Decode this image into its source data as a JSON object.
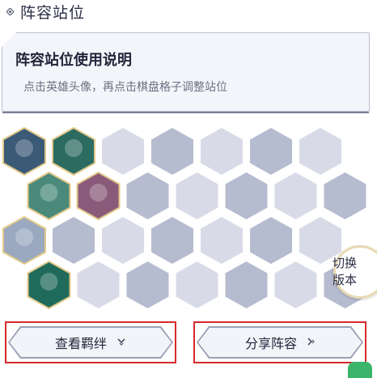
{
  "section": {
    "title": "阵容站位"
  },
  "info": {
    "title": "阵容站位使用说明",
    "description": "点击英雄头像，再点击棋盘格子调整站位"
  },
  "board": {
    "rows": 4,
    "cols": 7,
    "colors": {
      "light": "#d8dbe7",
      "dark": "#b6bccf"
    },
    "champions": [
      {
        "row": 0,
        "col": 0,
        "icon": "champion-portrait-1",
        "color": "#3b5a78"
      },
      {
        "row": 0,
        "col": 1,
        "icon": "champion-portrait-2",
        "color": "#2c6b62"
      },
      {
        "row": 1,
        "col": 0,
        "icon": "champion-portrait-3",
        "color": "#4b8a7a"
      },
      {
        "row": 1,
        "col": 1,
        "icon": "champion-portrait-4",
        "color": "#8a5a7a"
      },
      {
        "row": 2,
        "col": 0,
        "icon": "champion-portrait-5",
        "color": "#9aa8c0"
      },
      {
        "row": 3,
        "col": 0,
        "icon": "champion-portrait-6",
        "color": "#1f6a5a"
      }
    ]
  },
  "switch_version": {
    "line1": "切换",
    "line2": "版本"
  },
  "buttons": {
    "view_traits": {
      "label": "查看羁绊",
      "icon": "chevron-down-icon"
    },
    "share_lineup": {
      "label": "分享阵容",
      "icon": "chevron-right-icon"
    }
  }
}
